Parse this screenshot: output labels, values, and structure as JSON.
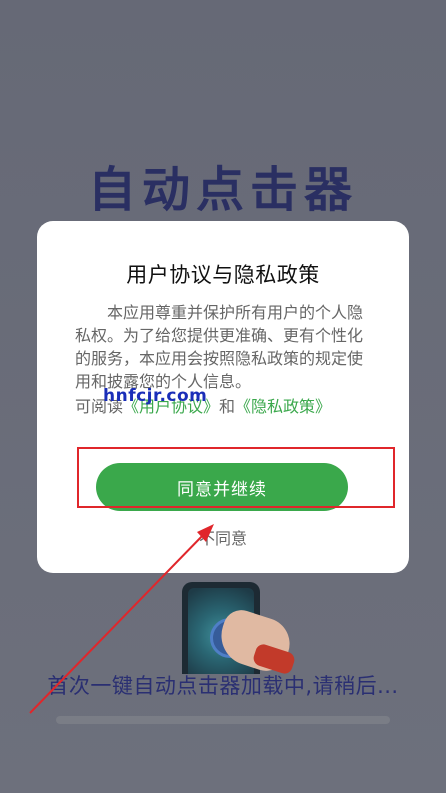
{
  "app": {
    "title": "自动点击器",
    "loading_text": "首次一键自动点击器加载中,请稍后...",
    "loading_progress": 0.0
  },
  "dialog": {
    "title": "用户协议与隐私政策",
    "body": "本应用尊重并保护所有用户的个人隐私权。为了给您提供更准确、更有个性化的服务，本应用会按照隐私政策的规定使用和披露您的个人信息。",
    "links_prefix": "可阅读",
    "user_agreement_link": "《用户协议》",
    "links_and": "和",
    "privacy_policy_link": "《隐私政策》",
    "agree_button": "同意并继续",
    "disagree_button": "不同意"
  },
  "overlay": {
    "watermark": "hnfcjr.com",
    "annotation_color": "#e0262b"
  },
  "colors": {
    "accent_green": "#3aa84b",
    "title_navy": "#2a2f62"
  }
}
